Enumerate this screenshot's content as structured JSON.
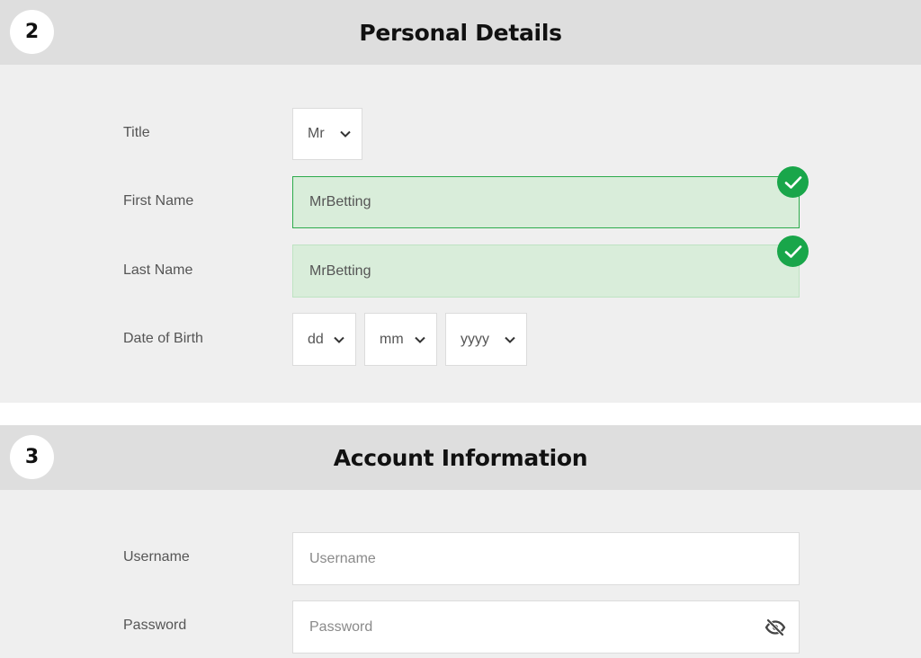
{
  "personal_details": {
    "step_number": "2",
    "title": "Personal Details",
    "title_field": {
      "label": "Title",
      "selected": "Mr"
    },
    "first_name": {
      "label": "First Name",
      "value": "MrBetting",
      "valid": true
    },
    "last_name": {
      "label": "Last Name",
      "value": "MrBetting",
      "valid": true
    },
    "date_of_birth": {
      "label": "Date of Birth",
      "day": "dd",
      "month": "mm",
      "year": "yyyy"
    }
  },
  "account_information": {
    "step_number": "3",
    "title": "Account Information",
    "username": {
      "label": "Username",
      "placeholder": "Username"
    },
    "password": {
      "label": "Password",
      "placeholder": "Password"
    }
  },
  "icons": {
    "valid": "check-icon",
    "select": "chevron-down-icon",
    "password_toggle": "eye-slash-icon"
  },
  "colors": {
    "header_bg": "#dedede",
    "body_bg": "#efefef",
    "valid_field_bg": "#d9edda",
    "valid_badge": "#19a64a"
  }
}
